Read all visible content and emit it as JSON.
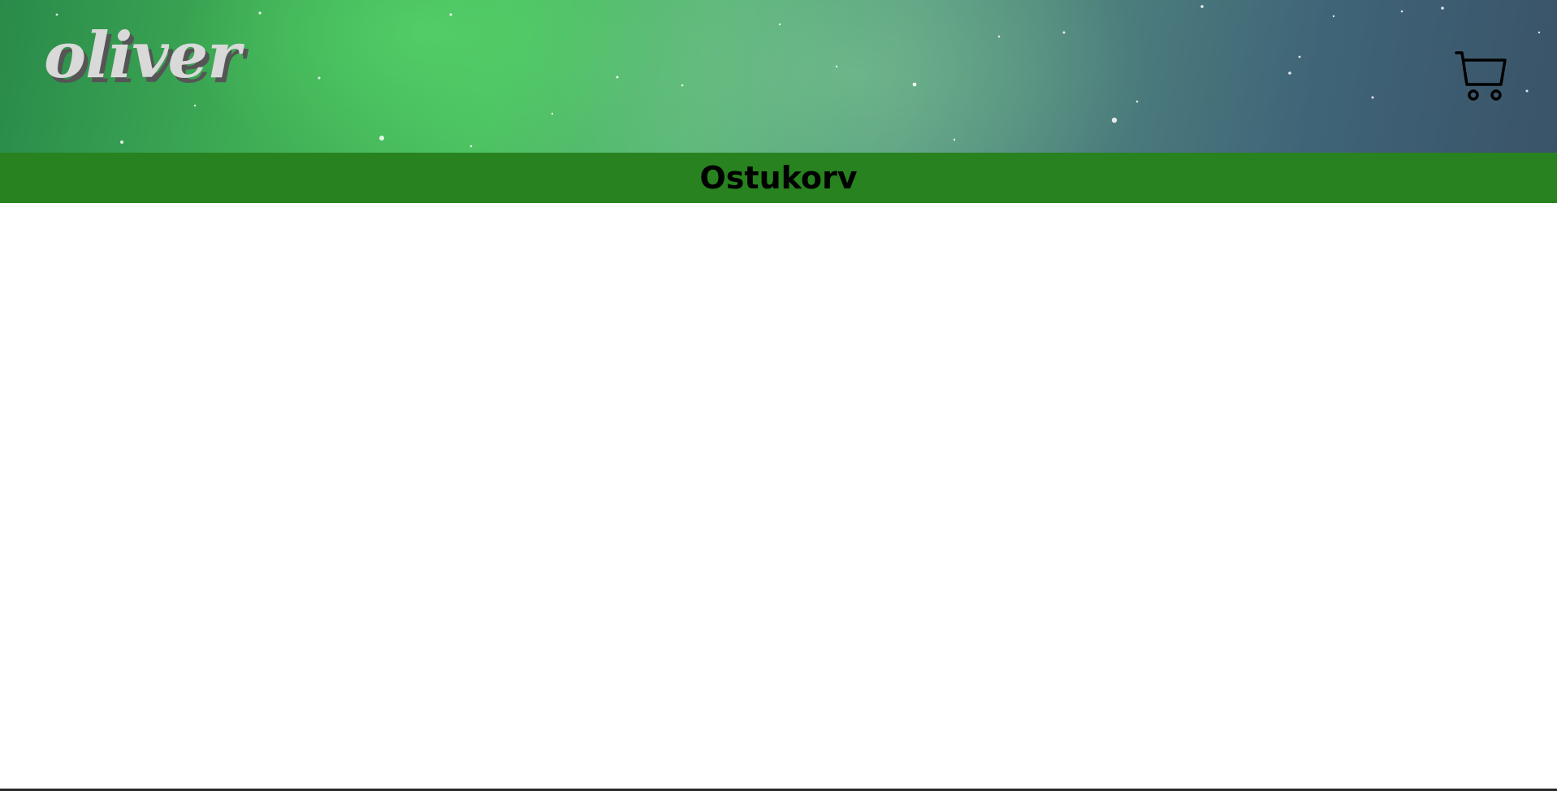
{
  "header": {
    "logo_text": "oliver",
    "cart_icon": "shopping-cart-icon"
  },
  "banner": {
    "title": "Ostukorv",
    "background_color": "#27821f"
  },
  "colors": {
    "page_background": "#ffffff",
    "logo_fill": "#d9d9d9",
    "logo_shadow": "#555555"
  }
}
